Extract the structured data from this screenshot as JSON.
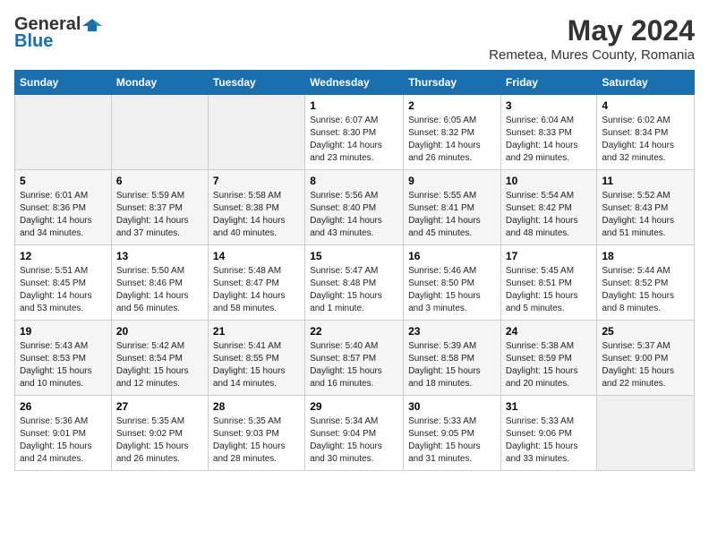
{
  "logo": {
    "general": "General",
    "blue": "Blue"
  },
  "title": "May 2024",
  "subtitle": "Remetea, Mures County, Romania",
  "days_of_week": [
    "Sunday",
    "Monday",
    "Tuesday",
    "Wednesday",
    "Thursday",
    "Friday",
    "Saturday"
  ],
  "weeks": [
    [
      {
        "day": "",
        "info": ""
      },
      {
        "day": "",
        "info": ""
      },
      {
        "day": "",
        "info": ""
      },
      {
        "day": "1",
        "info": "Sunrise: 6:07 AM\nSunset: 8:30 PM\nDaylight: 14 hours\nand 23 minutes."
      },
      {
        "day": "2",
        "info": "Sunrise: 6:05 AM\nSunset: 8:32 PM\nDaylight: 14 hours\nand 26 minutes."
      },
      {
        "day": "3",
        "info": "Sunrise: 6:04 AM\nSunset: 8:33 PM\nDaylight: 14 hours\nand 29 minutes."
      },
      {
        "day": "4",
        "info": "Sunrise: 6:02 AM\nSunset: 8:34 PM\nDaylight: 14 hours\nand 32 minutes."
      }
    ],
    [
      {
        "day": "5",
        "info": "Sunrise: 6:01 AM\nSunset: 8:36 PM\nDaylight: 14 hours\nand 34 minutes."
      },
      {
        "day": "6",
        "info": "Sunrise: 5:59 AM\nSunset: 8:37 PM\nDaylight: 14 hours\nand 37 minutes."
      },
      {
        "day": "7",
        "info": "Sunrise: 5:58 AM\nSunset: 8:38 PM\nDaylight: 14 hours\nand 40 minutes."
      },
      {
        "day": "8",
        "info": "Sunrise: 5:56 AM\nSunset: 8:40 PM\nDaylight: 14 hours\nand 43 minutes."
      },
      {
        "day": "9",
        "info": "Sunrise: 5:55 AM\nSunset: 8:41 PM\nDaylight: 14 hours\nand 45 minutes."
      },
      {
        "day": "10",
        "info": "Sunrise: 5:54 AM\nSunset: 8:42 PM\nDaylight: 14 hours\nand 48 minutes."
      },
      {
        "day": "11",
        "info": "Sunrise: 5:52 AM\nSunset: 8:43 PM\nDaylight: 14 hours\nand 51 minutes."
      }
    ],
    [
      {
        "day": "12",
        "info": "Sunrise: 5:51 AM\nSunset: 8:45 PM\nDaylight: 14 hours\nand 53 minutes."
      },
      {
        "day": "13",
        "info": "Sunrise: 5:50 AM\nSunset: 8:46 PM\nDaylight: 14 hours\nand 56 minutes."
      },
      {
        "day": "14",
        "info": "Sunrise: 5:48 AM\nSunset: 8:47 PM\nDaylight: 14 hours\nand 58 minutes."
      },
      {
        "day": "15",
        "info": "Sunrise: 5:47 AM\nSunset: 8:48 PM\nDaylight: 15 hours\nand 1 minute."
      },
      {
        "day": "16",
        "info": "Sunrise: 5:46 AM\nSunset: 8:50 PM\nDaylight: 15 hours\nand 3 minutes."
      },
      {
        "day": "17",
        "info": "Sunrise: 5:45 AM\nSunset: 8:51 PM\nDaylight: 15 hours\nand 5 minutes."
      },
      {
        "day": "18",
        "info": "Sunrise: 5:44 AM\nSunset: 8:52 PM\nDaylight: 15 hours\nand 8 minutes."
      }
    ],
    [
      {
        "day": "19",
        "info": "Sunrise: 5:43 AM\nSunset: 8:53 PM\nDaylight: 15 hours\nand 10 minutes."
      },
      {
        "day": "20",
        "info": "Sunrise: 5:42 AM\nSunset: 8:54 PM\nDaylight: 15 hours\nand 12 minutes."
      },
      {
        "day": "21",
        "info": "Sunrise: 5:41 AM\nSunset: 8:55 PM\nDaylight: 15 hours\nand 14 minutes."
      },
      {
        "day": "22",
        "info": "Sunrise: 5:40 AM\nSunset: 8:57 PM\nDaylight: 15 hours\nand 16 minutes."
      },
      {
        "day": "23",
        "info": "Sunrise: 5:39 AM\nSunset: 8:58 PM\nDaylight: 15 hours\nand 18 minutes."
      },
      {
        "day": "24",
        "info": "Sunrise: 5:38 AM\nSunset: 8:59 PM\nDaylight: 15 hours\nand 20 minutes."
      },
      {
        "day": "25",
        "info": "Sunrise: 5:37 AM\nSunset: 9:00 PM\nDaylight: 15 hours\nand 22 minutes."
      }
    ],
    [
      {
        "day": "26",
        "info": "Sunrise: 5:36 AM\nSunset: 9:01 PM\nDaylight: 15 hours\nand 24 minutes."
      },
      {
        "day": "27",
        "info": "Sunrise: 5:35 AM\nSunset: 9:02 PM\nDaylight: 15 hours\nand 26 minutes."
      },
      {
        "day": "28",
        "info": "Sunrise: 5:35 AM\nSunset: 9:03 PM\nDaylight: 15 hours\nand 28 minutes."
      },
      {
        "day": "29",
        "info": "Sunrise: 5:34 AM\nSunset: 9:04 PM\nDaylight: 15 hours\nand 30 minutes."
      },
      {
        "day": "30",
        "info": "Sunrise: 5:33 AM\nSunset: 9:05 PM\nDaylight: 15 hours\nand 31 minutes."
      },
      {
        "day": "31",
        "info": "Sunrise: 5:33 AM\nSunset: 9:06 PM\nDaylight: 15 hours\nand 33 minutes."
      },
      {
        "day": "",
        "info": ""
      }
    ]
  ]
}
